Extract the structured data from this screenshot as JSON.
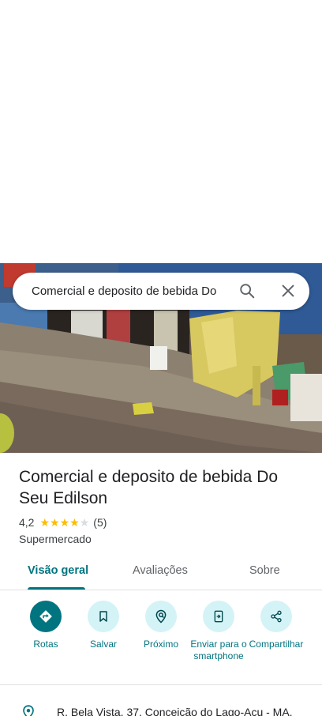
{
  "search": {
    "query": "Comercial e deposito de bebida Do"
  },
  "place": {
    "title": "Comercial e deposito de bebida Do Seu Edilson",
    "rating": "4,2",
    "rating_value": 4.2,
    "review_count": "(5)",
    "category": "Supermercado"
  },
  "tabs": [
    {
      "label": "Visão geral",
      "active": true
    },
    {
      "label": "Avaliações",
      "active": false
    },
    {
      "label": "Sobre",
      "active": false
    }
  ],
  "actions": [
    {
      "label": "Rotas",
      "icon": "directions-icon"
    },
    {
      "label": "Salvar",
      "icon": "bookmark-icon"
    },
    {
      "label": "Próximo",
      "icon": "nearby-icon"
    },
    {
      "label": "Enviar para o smartphone",
      "icon": "send-to-phone-icon"
    },
    {
      "label": "Compartilhar",
      "icon": "share-icon"
    }
  ],
  "address": {
    "text": "R. Bela Vista, 37, Conceicão do Lago-Açu - MA,"
  },
  "colors": {
    "accent": "#00747f",
    "action_bg": "#d4f3f7",
    "star": "#fbbc04"
  }
}
